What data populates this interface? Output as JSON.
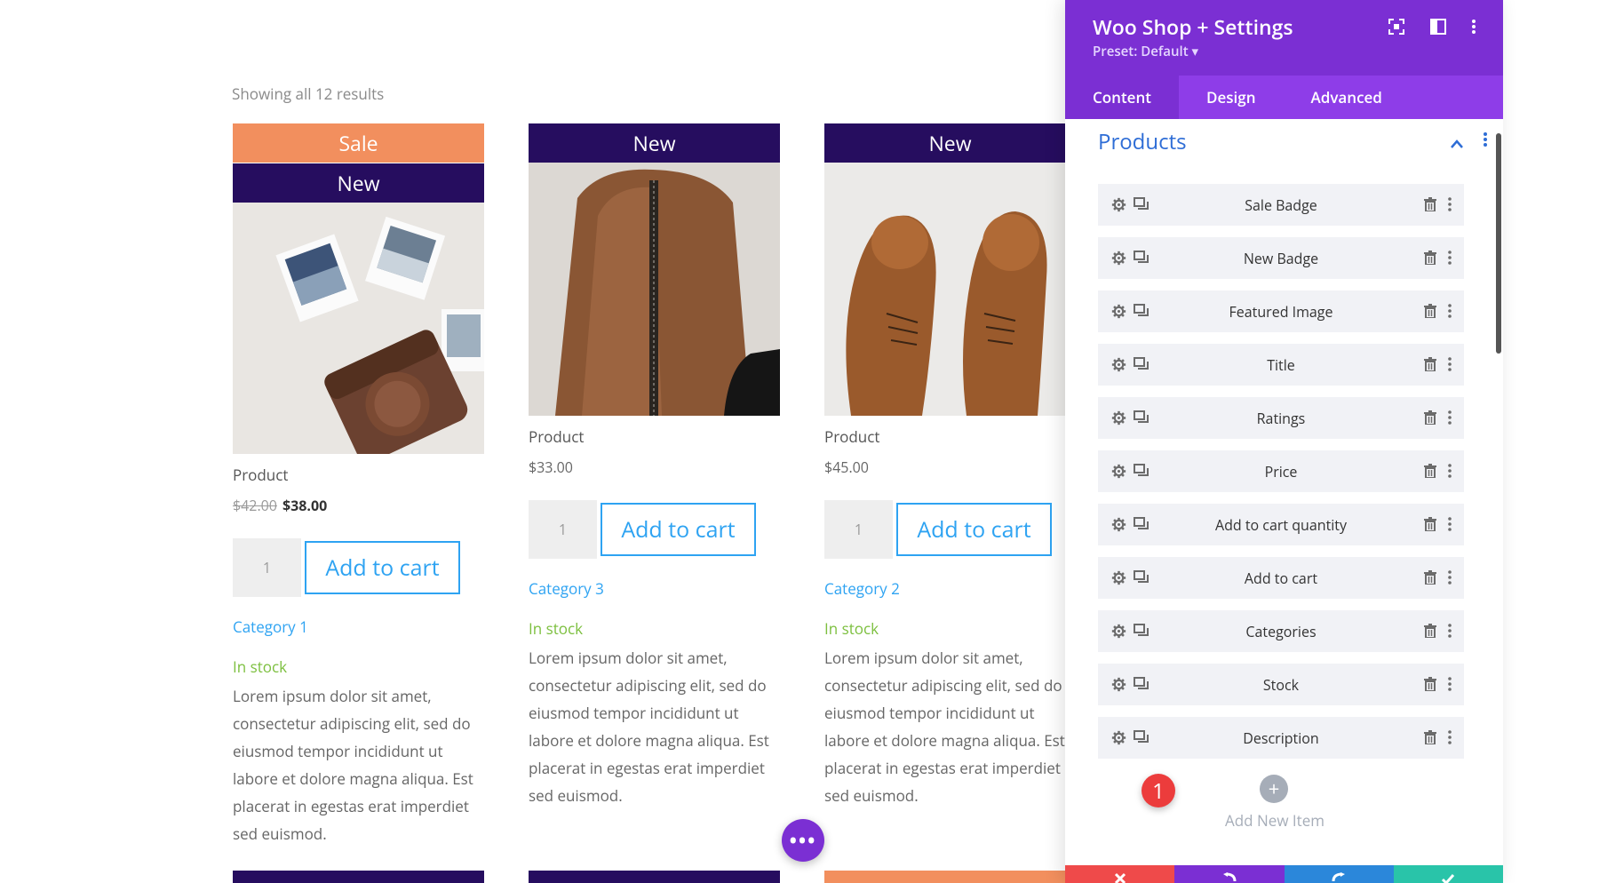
{
  "shop": {
    "results_text": "Showing all 12 results",
    "products": [
      {
        "badges": [
          "Sale",
          "New"
        ],
        "name": "Product",
        "old_price": "$42.00",
        "price": "$38.00",
        "qty": "1",
        "cart_label": "Add to cart",
        "category": "Category 1",
        "stock": "In stock",
        "description": "Lorem ipsum dolor sit amet, consectetur adipiscing elit, sed do eiusmod tempor incididunt ut labore et dolore magna aliqua. Est placerat in egestas erat imperdiet sed euismod."
      },
      {
        "badges": [
          "New"
        ],
        "name": "Product",
        "price": "$33.00",
        "qty": "1",
        "cart_label": "Add to cart",
        "category": "Category 3",
        "stock": "In stock",
        "description": "Lorem ipsum dolor sit amet, consectetur adipiscing elit, sed do eiusmod tempor incididunt ut labore et dolore magna aliqua. Est placerat in egestas erat imperdiet sed euismod."
      },
      {
        "badges": [
          "New"
        ],
        "name": "Product",
        "price": "$45.00",
        "qty": "1",
        "cart_label": "Add to cart",
        "category": "Category 2",
        "stock": "In stock",
        "description": "Lorem ipsum dolor sit amet, consectetur adipiscing elit, sed do eiusmod tempor incididunt ut labore et dolore magna aliqua. Est placerat in egestas erat imperdiet sed euismod."
      }
    ],
    "fab_label": "•••"
  },
  "panel": {
    "title": "Woo Shop + Settings",
    "preset": "Preset: Default ▾",
    "tabs": [
      "Content",
      "Design",
      "Advanced"
    ],
    "active_tab": "Content",
    "section_title": "Products",
    "items": [
      "Sale Badge",
      "New Badge",
      "Featured Image",
      "Title",
      "Ratings",
      "Price",
      "Add to cart quantity",
      "Add to cart",
      "Categories",
      "Stock",
      "Description"
    ],
    "notification_count": "1",
    "add_item_label": "Add New Item",
    "colors": {
      "header": "#7b2fd3",
      "tabs": "#8e3de8",
      "footer_cancel": "#ef4a4a",
      "footer_undo": "#7b2fd3",
      "footer_redo": "#2b87da",
      "footer_save": "#29c4a9"
    }
  }
}
